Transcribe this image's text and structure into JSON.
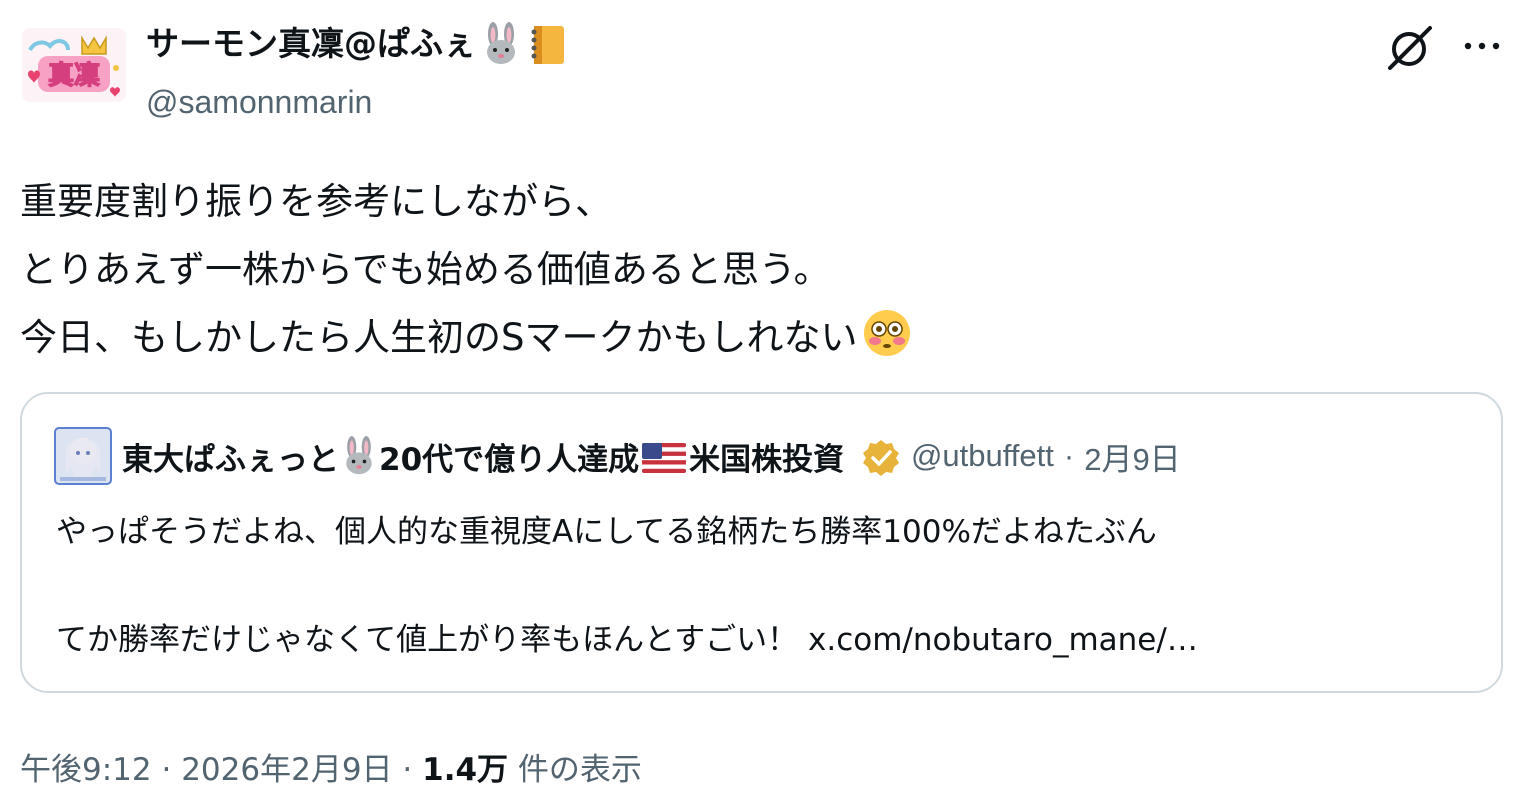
{
  "author": {
    "display_name": "サーモン真凜@ぱふぇ",
    "name_emoji": [
      "rabbit-face",
      "notebook"
    ],
    "handle": "@samonnmarin",
    "avatar_text": "真凜"
  },
  "header_actions": {
    "grok_icon": "grok-icon",
    "more_icon": "more-icon"
  },
  "tweet": {
    "lines": [
      "重要度割り振りを参考にしながら、",
      "とりあえず一株からでも始める価値あると思う。",
      "今日、もしかしたら人生初のSマークかもしれない"
    ],
    "trailing_emoji": "flushed-face"
  },
  "quote": {
    "name_part1": "東大ぱふぇっと",
    "name_part2": "20代で億り人達成",
    "name_part3": "米国株投資",
    "handle": "@utbuffett",
    "separator": "·",
    "date": "2月9日",
    "line1": "やっぱそうだよね、個人的な重視度Aにしてる銘柄たち勝率100%だよねたぶん",
    "line2": "てか勝率だけじゃなくて値上がり率もほんとすごい！ x.com/nobutaro_mane/…"
  },
  "meta": {
    "time": "午後9:12",
    "sep1": "·",
    "date": "2026年2月9日",
    "sep2": "·",
    "views_count": "1.4万",
    "views_label": "件の表示"
  },
  "colors": {
    "text": "#0f1419",
    "secondary": "#536471",
    "border": "#cfd9de",
    "verified_gold": "#e8b33a"
  }
}
